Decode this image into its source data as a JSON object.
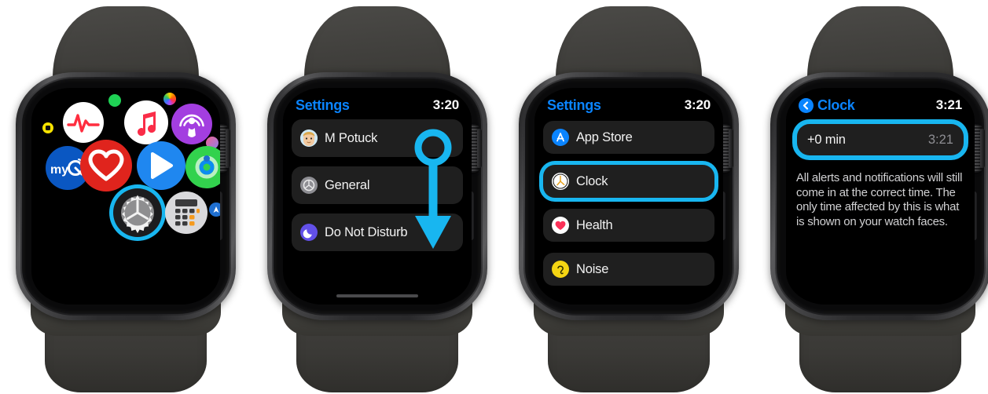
{
  "meta": {
    "description": "Four Apple Watch screenshots showing steps to change the watch face time offset",
    "accent_highlight": "#18b6f0",
    "accent_link": "#0a84ff",
    "screen_background": "#000000",
    "row_background": "#1f1f1f"
  },
  "watch1": {
    "name": "app-grid-screen",
    "apps": [
      {
        "name": "workout-badge-icon",
        "label": "Workout"
      },
      {
        "name": "ecg-icon",
        "label": "ECG"
      },
      {
        "name": "status-green-dot-icon",
        "label": "Activity Dot"
      },
      {
        "name": "music-icon",
        "label": "Music"
      },
      {
        "name": "photos-icon",
        "label": "Photos"
      },
      {
        "name": "podcasts-icon",
        "label": "Podcasts"
      },
      {
        "name": "shortcuts-small-icon",
        "label": "Shortcuts"
      },
      {
        "name": "myq-icon",
        "label": "myQ"
      },
      {
        "name": "heart-rate-icon",
        "label": "Heart Rate"
      },
      {
        "name": "now-playing-icon",
        "label": "Now Playing"
      },
      {
        "name": "activity-rings-icon",
        "label": "Activity"
      },
      {
        "name": "settings-icon",
        "label": "Settings",
        "highlighted": true
      },
      {
        "name": "calculator-icon",
        "label": "Calculator"
      },
      {
        "name": "maps-small-icon",
        "label": "Maps"
      }
    ],
    "highlighted_app": "Settings"
  },
  "watch2": {
    "name": "settings-screen-top",
    "status": {
      "title": "Settings",
      "time": "3:20"
    },
    "rows": [
      {
        "icon": "memoji-avatar",
        "label": "M Potuck"
      },
      {
        "icon": "general-gear-icon",
        "label": "General"
      },
      {
        "icon": "do-not-disturb-moon-icon",
        "label": "Do Not Disturb"
      }
    ],
    "annotation": {
      "type": "scroll-down-arrow",
      "color": "#18b6f0"
    }
  },
  "watch3": {
    "name": "settings-screen-scrolled",
    "status": {
      "title": "Settings",
      "time": "3:20"
    },
    "rows": [
      {
        "icon": "app-store-icon",
        "label": "App Store",
        "highlighted": false
      },
      {
        "icon": "clock-icon",
        "label": "Clock",
        "highlighted": true
      },
      {
        "icon": "health-heart-icon",
        "label": "Health",
        "highlighted": false
      },
      {
        "icon": "noise-ear-icon",
        "label": "Noise",
        "highlighted": false
      }
    ],
    "highlighted_row": "Clock"
  },
  "watch4": {
    "name": "clock-settings-screen",
    "status": {
      "back_icon": "chevron-left-icon",
      "title": "Clock",
      "time": "3:21"
    },
    "offset_row": {
      "label": "+0 min",
      "value": "3:21",
      "highlighted": true
    },
    "description": "All alerts and notifications will still come in at the correct time. The only time affected by this is what is shown on your watch faces."
  }
}
